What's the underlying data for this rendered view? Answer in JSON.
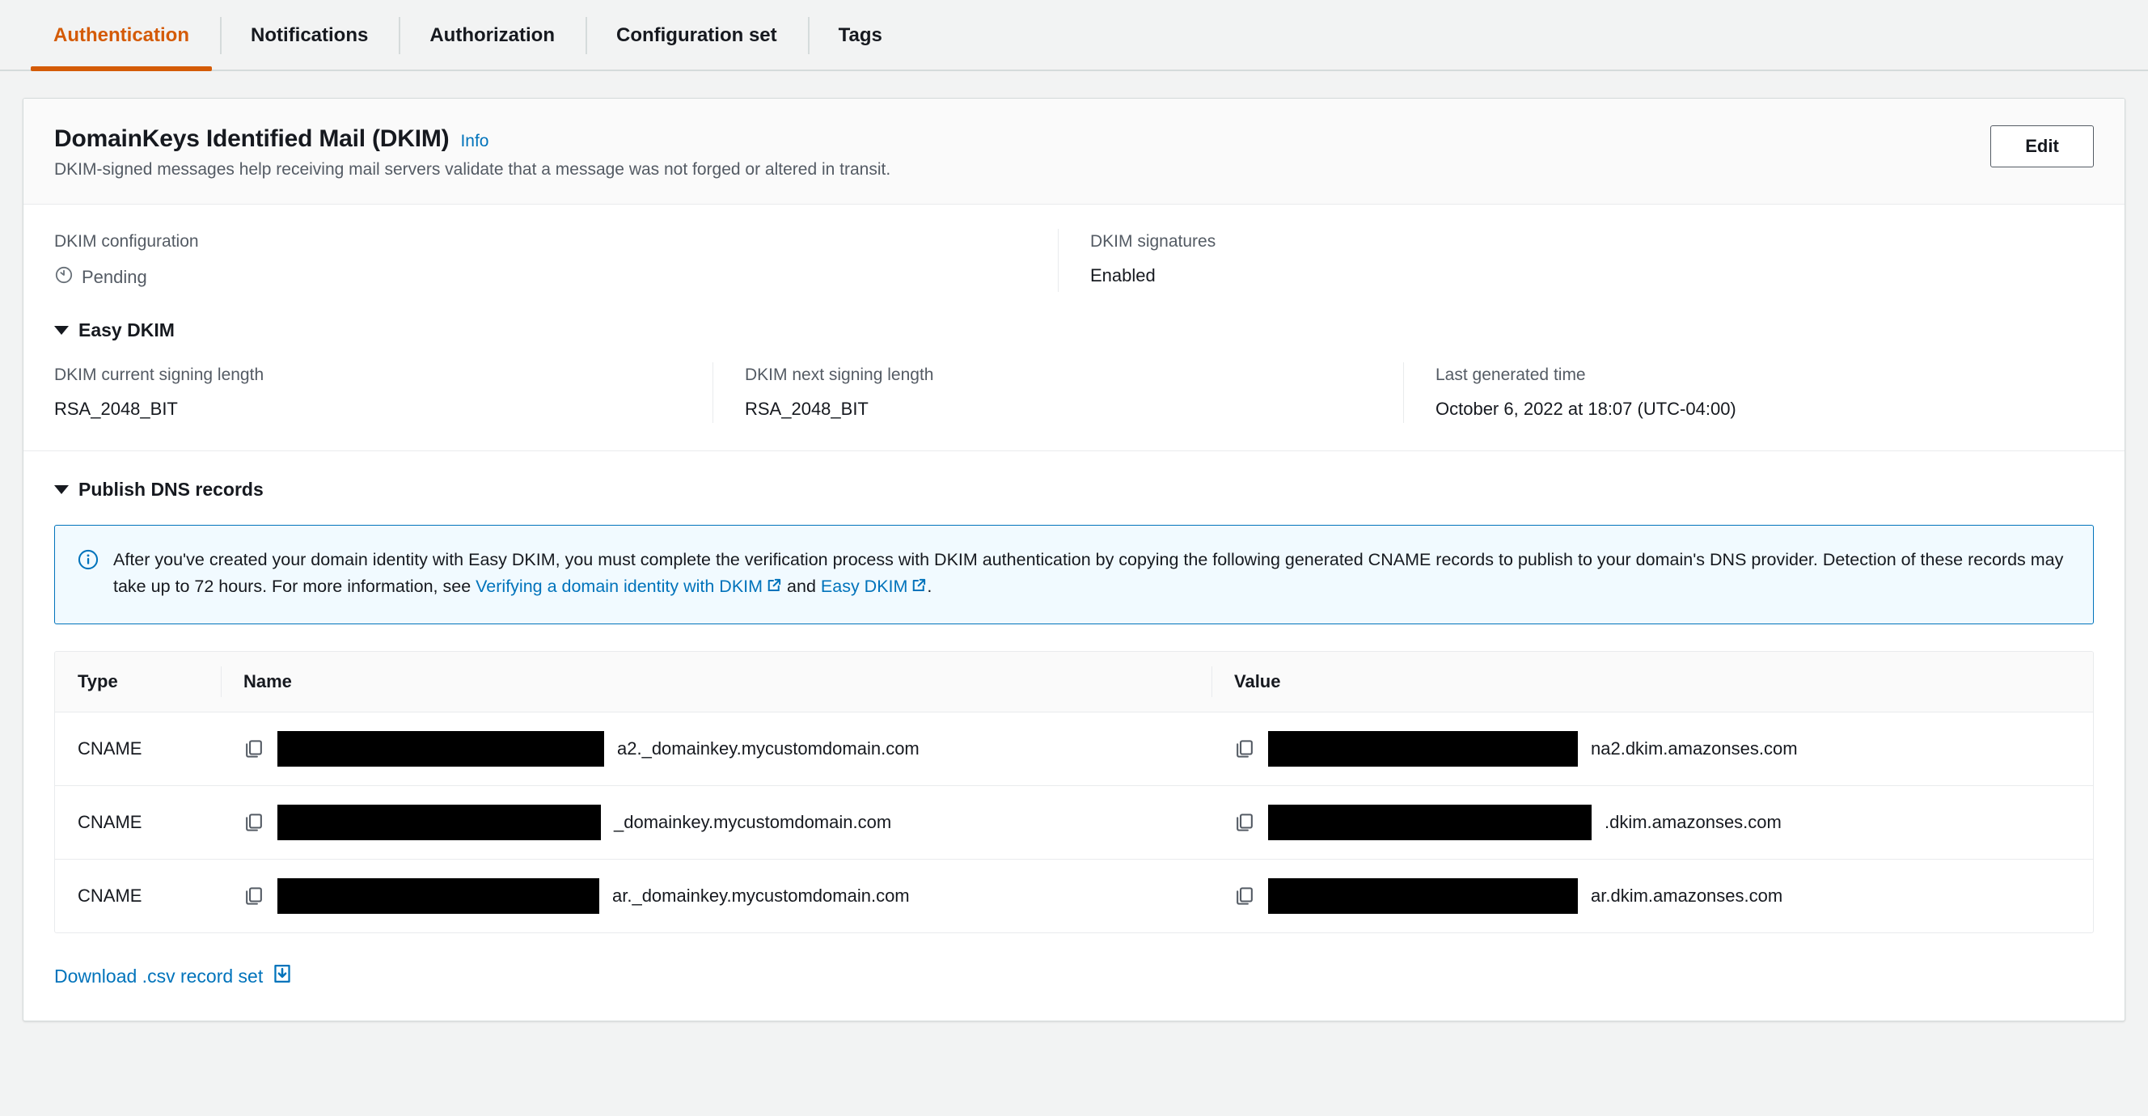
{
  "tabs": [
    {
      "label": "Authentication",
      "active": true
    },
    {
      "label": "Notifications",
      "active": false
    },
    {
      "label": "Authorization",
      "active": false
    },
    {
      "label": "Configuration set",
      "active": false
    },
    {
      "label": "Tags",
      "active": false
    }
  ],
  "card": {
    "title": "DomainKeys Identified Mail (DKIM)",
    "info_label": "Info",
    "description": "DKIM-signed messages help receiving mail servers validate that a message was not forged or altered in transit.",
    "edit_label": "Edit"
  },
  "status_row": {
    "dkim_configuration_label": "DKIM configuration",
    "dkim_configuration_value": "Pending",
    "dkim_signatures_label": "DKIM signatures",
    "dkim_signatures_value": "Enabled"
  },
  "easy_dkim": {
    "section_label": "Easy DKIM",
    "current_signing_length_label": "DKIM current signing length",
    "current_signing_length_value": "RSA_2048_BIT",
    "next_signing_length_label": "DKIM next signing length",
    "next_signing_length_value": "RSA_2048_BIT",
    "last_generated_time_label": "Last generated time",
    "last_generated_time_value": "October 6, 2022 at 18:07 (UTC-04:00)"
  },
  "publish_dns": {
    "section_label": "Publish DNS records",
    "alert": {
      "text_part1": "After you've created your domain identity with Easy DKIM, you must complete the verification process with DKIM authentication by copying the following generated CNAME records to publish to your domain's DNS provider. Detection of these records may take up to 72 hours. For more information, see ",
      "link1": "Verifying a domain identity with DKIM",
      "text_mid": " and ",
      "link2": "Easy DKIM",
      "text_end": "."
    },
    "table": {
      "headers": [
        "Type",
        "Name",
        "Value"
      ],
      "rows": [
        {
          "type": "CNAME",
          "name_redacted": true,
          "name_suffix": "a2._domainkey.mycustomdomain.com",
          "value_redacted": true,
          "value_suffix": "na2.dkim.amazonses.com"
        },
        {
          "type": "CNAME",
          "name_redacted": true,
          "name_suffix": "_domainkey.mycustomdomain.com",
          "value_redacted": true,
          "value_suffix": ".dkim.amazonses.com"
        },
        {
          "type": "CNAME",
          "name_redacted": true,
          "name_suffix": "ar._domainkey.mycustomdomain.com",
          "value_redacted": true,
          "value_suffix": "ar.dkim.amazonses.com"
        }
      ]
    },
    "download_label": "Download .csv record set"
  },
  "colors": {
    "accent_orange": "#d45b07",
    "link_blue": "#0073bb",
    "alert_bg": "#f1faff",
    "page_bg": "#f2f3f3",
    "text_primary": "#16191f",
    "text_secondary": "#545b64"
  }
}
